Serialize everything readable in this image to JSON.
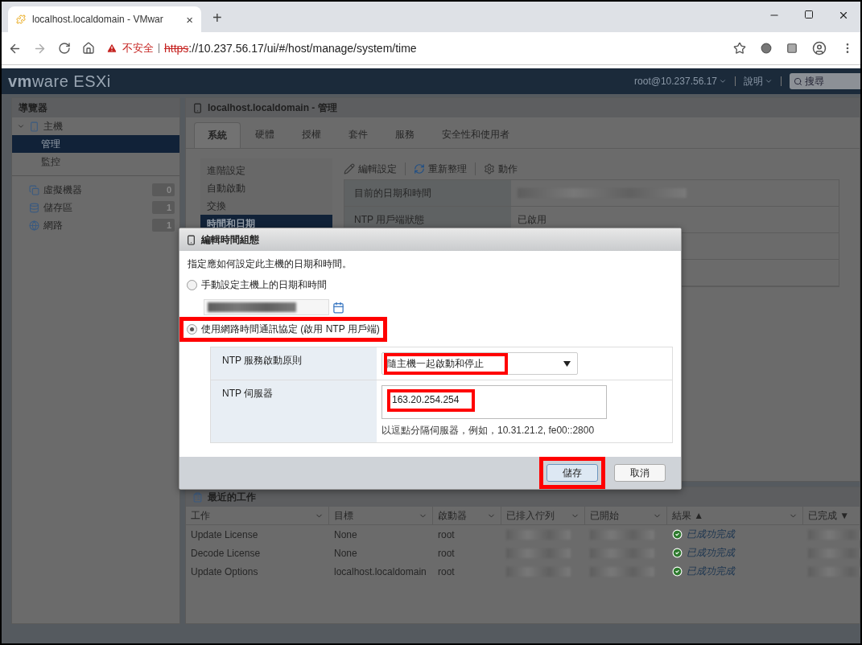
{
  "browser": {
    "tab_title": "localhost.localdomain - VMwar",
    "tab_close": "×",
    "new_tab": "+",
    "security_label": "不安全",
    "url_scheme": "https",
    "url_rest": "://10.237.56.17/ui/#/host/manage/system/time"
  },
  "header": {
    "logo_brand": "vm",
    "logo_ware": "ware",
    "logo_product": "ESXi",
    "user": "root@10.237.56.17",
    "help": "說明",
    "search_placeholder": "搜尋"
  },
  "navigator": {
    "title": "導覽器",
    "items": [
      {
        "label": "主機",
        "kind": "host",
        "expanded": true,
        "children": [
          {
            "label": "管理",
            "selected": true
          },
          {
            "label": "監控",
            "selected": false
          }
        ]
      },
      {
        "label": "虛擬機器",
        "kind": "vm",
        "count": "0"
      },
      {
        "label": "儲存區",
        "kind": "storage",
        "count": "1"
      },
      {
        "label": "網路",
        "kind": "network",
        "count": "1"
      }
    ]
  },
  "main": {
    "title": "localhost.localdomain - 管理",
    "tabs": [
      {
        "label": "系統",
        "selected": true
      },
      {
        "label": "硬體",
        "selected": false
      },
      {
        "label": "授權",
        "selected": false
      },
      {
        "label": "套件",
        "selected": false
      },
      {
        "label": "服務",
        "selected": false
      },
      {
        "label": "安全性和使用者",
        "selected": false
      }
    ],
    "submenu": [
      {
        "label": "進階設定",
        "selected": false
      },
      {
        "label": "自動啟動",
        "selected": false
      },
      {
        "label": "交換",
        "selected": false
      },
      {
        "label": "時間和日期",
        "selected": true
      }
    ],
    "toolbar": [
      {
        "kind": "edit",
        "label": "編輯設定"
      },
      {
        "kind": "refresh",
        "label": "重新整理"
      },
      {
        "kind": "actions",
        "label": "動作"
      }
    ],
    "rows": [
      {
        "label": "目前的日期和時間"
      },
      {
        "label": "NTP 用戶端狀態",
        "value": "已啟用"
      }
    ]
  },
  "dialog": {
    "title": "編輯時間組態",
    "instruction": "指定應如何設定此主機的日期和時間。",
    "options": [
      {
        "label": "手動設定主機上的日期和時間",
        "selected": false,
        "highlighted": false
      },
      {
        "label": "使用網路時間通訊協定 (啟用 NTP 用戶端)",
        "selected": true,
        "highlighted": true
      }
    ],
    "startup_policy": {
      "label": "NTP 服務啟動原則",
      "value": "隨主機一起啟動和停止",
      "highlighted": true
    },
    "servers": {
      "label": "NTP 伺服器",
      "value": "163.20.254.254",
      "hint": "以逗點分隔伺服器，例如，10.31.21.2, fe00::2800",
      "highlighted": true
    },
    "buttons": [
      {
        "label": "儲存",
        "primary": true,
        "highlighted": true
      },
      {
        "label": "取消",
        "primary": false,
        "highlighted": false
      }
    ]
  },
  "recent_tasks": {
    "title": "最近的工作",
    "columns": [
      "工作",
      "目標",
      "啟動器",
      "已排入佇列",
      "已開始",
      "結果 ▲",
      "已完成 ▼"
    ],
    "rows": [
      [
        {
          "kind": "text",
          "text": "Update License"
        },
        {
          "kind": "text",
          "text": "None"
        },
        {
          "kind": "text",
          "text": "root"
        },
        {
          "kind": "redacted"
        },
        {
          "kind": "redacted"
        },
        {
          "kind": "status",
          "text": "已成功完成"
        },
        {
          "kind": "redacted"
        }
      ],
      [
        {
          "kind": "text",
          "text": "Decode License"
        },
        {
          "kind": "text",
          "text": "None"
        },
        {
          "kind": "text",
          "text": "root"
        },
        {
          "kind": "redacted"
        },
        {
          "kind": "redacted"
        },
        {
          "kind": "status",
          "text": "已成功完成"
        },
        {
          "kind": "redacted"
        }
      ],
      [
        {
          "kind": "text",
          "text": "Update Options"
        },
        {
          "kind": "text",
          "text": "localhost.localdomain"
        },
        {
          "kind": "text",
          "text": "root"
        },
        {
          "kind": "redacted"
        },
        {
          "kind": "redacted"
        },
        {
          "kind": "status",
          "text": "已成功完成"
        },
        {
          "kind": "redacted"
        }
      ]
    ]
  }
}
